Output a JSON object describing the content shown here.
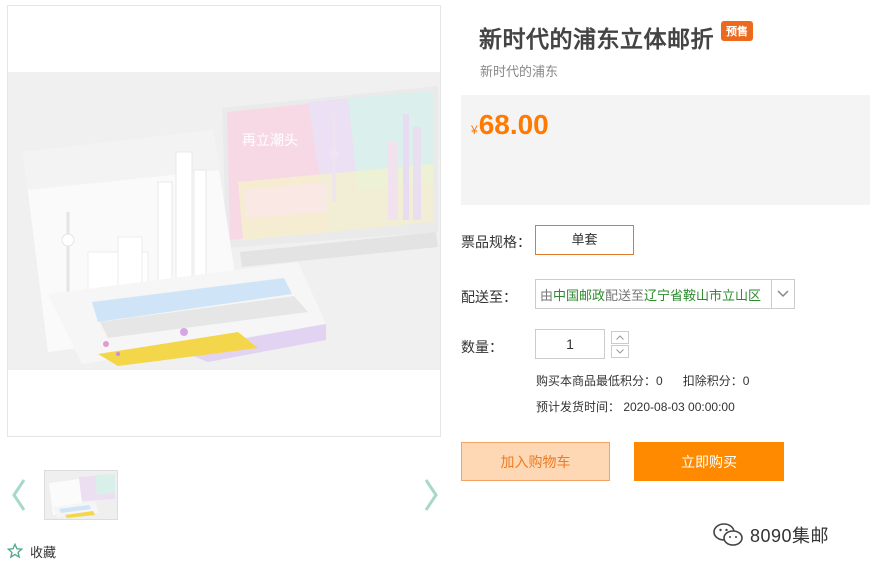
{
  "product": {
    "title": "新时代的浦东立体邮折",
    "badge": "预售",
    "subtitle": "新时代的浦东",
    "price_symbol": "¥",
    "price": "68.00",
    "image_artwork_text": "再立潮头"
  },
  "spec": {
    "label": "票品规格：",
    "option": "单套"
  },
  "shipping": {
    "label": "配送至：",
    "prefix": "由",
    "carrier": "中国邮政",
    "middle": "配送至",
    "destination": "辽宁省鞍山市立山区"
  },
  "quantity": {
    "label": "数量：",
    "value": "1"
  },
  "points": {
    "min_points": "购买本商品最低积分：0",
    "deduct_points": "扣除积分：0"
  },
  "ship_date": "预计发货时间： 2020-08-03 00:00:00",
  "actions": {
    "add_to_cart": "加入购物车",
    "buy_now": "立即购买"
  },
  "favorite": {
    "label": "收藏"
  },
  "watermark": {
    "text": "8090集邮"
  },
  "icons": {
    "prev": "chevron-left-icon",
    "next": "chevron-right-icon",
    "favorite": "star-outline-icon",
    "dropdown": "chevron-down-icon",
    "qty_up": "triangle-up-icon",
    "qty_down": "triangle-down-icon",
    "watermark": "wechat-icon"
  },
  "colors": {
    "accent": "#ff8a00",
    "badge": "#ec6a1e",
    "price": "#ff7a00",
    "cart_bg": "#fed8b4",
    "chevron": "#a8d8cc",
    "ship_green": "#2c8a2c"
  }
}
